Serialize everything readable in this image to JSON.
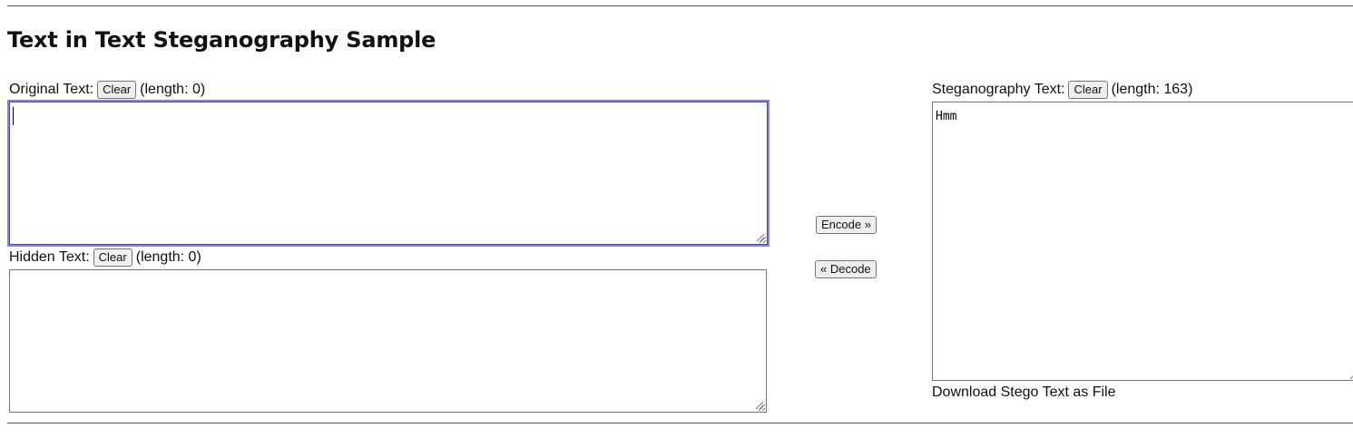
{
  "page": {
    "title": "Text in Text Steganography Sample"
  },
  "original": {
    "label": "Original Text:",
    "clear_label": "Clear",
    "length_text": "(length: 0)",
    "value": ""
  },
  "hidden": {
    "label": "Hidden Text:",
    "clear_label": "Clear",
    "length_text": "(length: 0)",
    "value": ""
  },
  "stego": {
    "label": "Steganography Text:",
    "clear_label": "Clear",
    "length_text": "(length: 163)",
    "value": "Hmm",
    "download_label": "Download Stego Text as File"
  },
  "actions": {
    "encode_label": "Encode »",
    "decode_label": "« Decode"
  },
  "colors": {
    "focus_outline": "#8b80e6",
    "rule": "#555555"
  },
  "icons": {
    "resize_grip": "resize-grip-icon"
  }
}
